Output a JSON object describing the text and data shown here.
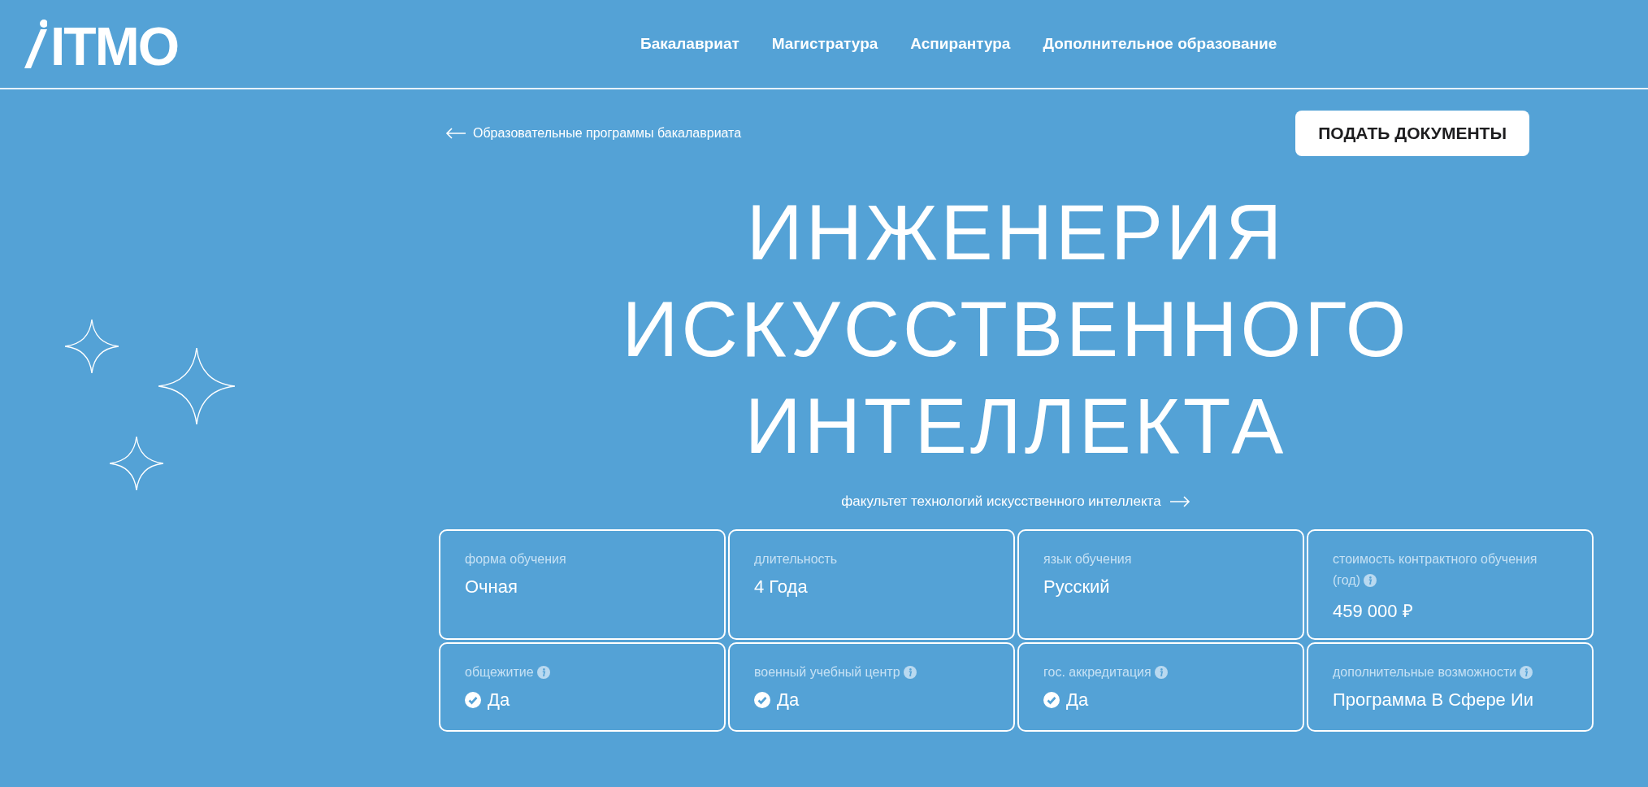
{
  "header": {
    "logo": "ITMO",
    "nav": [
      {
        "label": "Бакалавриат"
      },
      {
        "label": "Магистратура"
      },
      {
        "label": "Аспирантура"
      },
      {
        "label": "Дополнительное образование"
      }
    ]
  },
  "back_link": "Образовательные программы бакалавриата",
  "apply_button": "ПОДАТЬ ДОКУМЕНТЫ",
  "title_lines": [
    "ИНЖЕНЕРИЯ",
    "ИСКУССТВЕННОГО",
    "ИНТЕЛЛЕКТА"
  ],
  "faculty_link": "факультет технологий искусственного интеллекта",
  "cards": [
    {
      "kind": "text",
      "label": "форма обучения",
      "info": false,
      "value": "Очная"
    },
    {
      "kind": "text",
      "label": "длительность",
      "info": false,
      "value": "4 Года"
    },
    {
      "kind": "text",
      "label": "язык обучения",
      "info": false,
      "value": "Русский"
    },
    {
      "kind": "text",
      "label": "стоимость контрактного обучения (год)",
      "info": true,
      "value": "459 000 ₽"
    },
    {
      "kind": "check",
      "label": "общежитие",
      "info": true,
      "value": "Да"
    },
    {
      "kind": "check",
      "label": "военный учебный центр",
      "info": true,
      "value": "Да"
    },
    {
      "kind": "check",
      "label": "гос. аккредитация",
      "info": true,
      "value": "Да"
    },
    {
      "kind": "text",
      "label": "дополнительные возможности",
      "info": true,
      "value": "Программа В Сфере Ии"
    }
  ]
}
